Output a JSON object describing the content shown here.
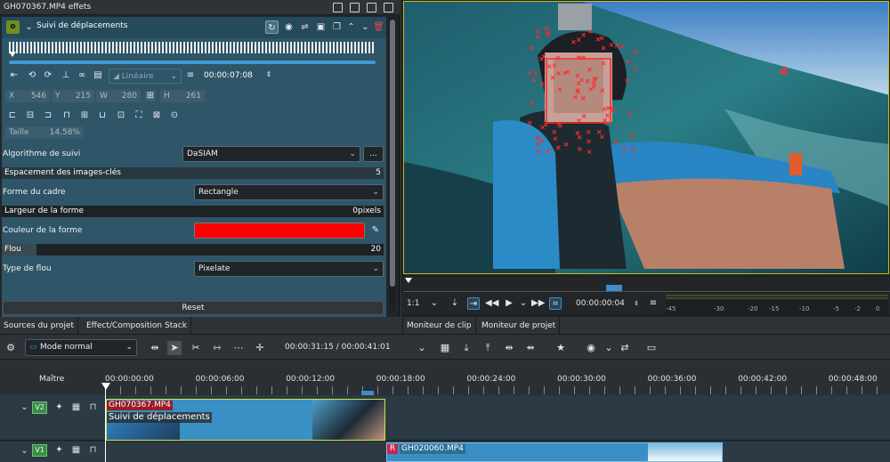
{
  "effects": {
    "window_title": "GH070367.MP4 effets",
    "effect_badge": "o",
    "effect_name": "Suivi de déplacements",
    "interpolation": "Linéaire",
    "time": "00:00:07:08",
    "geometry": {
      "x_label": "X",
      "x": "546",
      "y_label": "Y",
      "y": "215",
      "w_label": "W",
      "w": "280",
      "h_label": "H",
      "h": "261",
      "size_label": "Taille",
      "size": "14.58%"
    },
    "algorithm_label": "Algorithme de suivi",
    "algorithm_value": "DaSIAM",
    "algorithm_more": "...",
    "spacing_label": "Espacement des images-clés",
    "spacing_value": "5",
    "frame_shape_label": "Forme du cadre",
    "frame_shape_value": "Rectangle",
    "shape_width_label": "Largeur de la forme",
    "shape_width_value": "0pixels",
    "shape_color_label": "Couleur de la forme",
    "shape_color": "#ff0000",
    "blur_label": "Flou",
    "blur_value": "20",
    "blur_type_label": "Type de flou",
    "blur_type_value": "Pixelate",
    "reset_label": "Reset"
  },
  "monitor": {
    "zoom": "1:1",
    "timecode": "00:00:00:04",
    "meter_labels": [
      "-45",
      "-30",
      "-20",
      "-15",
      "-10",
      "-5",
      "-2",
      "0"
    ]
  },
  "tabs": {
    "left": [
      "Sources du projet",
      "Effect/Composition Stack"
    ],
    "right": [
      "Moniteur de clip",
      "Moniteur de projet"
    ]
  },
  "toolbar": {
    "mode": "Mode normal",
    "position": "00:00:31:15 / 00:00:41:01"
  },
  "timeline": {
    "master_label": "Maître",
    "ticks": [
      "00:00:00:00",
      "00:00:06:00",
      "00:00:12:00",
      "00:00:18:00",
      "00:00:24:00",
      "00:00:30:00",
      "00:00:36:00",
      "00:00:42:00",
      "00:00:48:00"
    ],
    "tracks": [
      {
        "label": "V2",
        "clip_name": "GH070367.MP4",
        "clip_effect": "Suivi de déplacements"
      },
      {
        "label": "V1",
        "clip_badge": "R",
        "clip_name": "GH020060.MP4"
      }
    ]
  },
  "colors": {
    "accent": "#3d9bd6",
    "track_badge": "#3c8a47",
    "clip": "#3a8fc4",
    "tracking_box": "#ff2a2a"
  }
}
